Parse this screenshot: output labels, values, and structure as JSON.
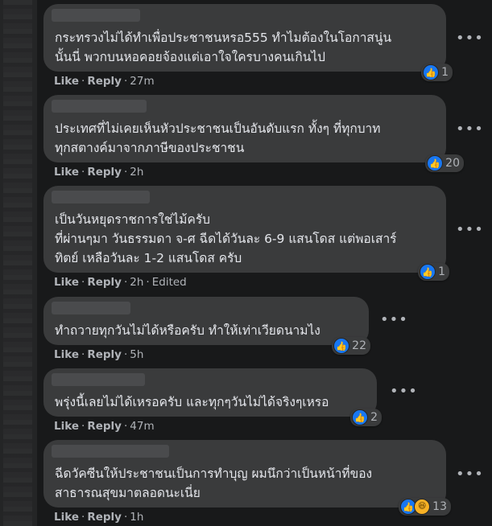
{
  "comments": [
    {
      "text": "กระทรวงไม่ได้ทำเพื่อประชาชนหรอ555 ทำไมต้องในโอกาสนู่น\nนั้นนี่ พวกบนหอคอยจ้องแต่เอาใจใครบางคนเกินไป",
      "like": "Like",
      "reply": "Reply",
      "time": "27m",
      "edited": "",
      "reactions": [
        "like"
      ],
      "reaction_count": "1"
    },
    {
      "text": "ประเทศที่ไม่เคยเห็นหัวประชาชนเป็นอันดับแรก ทั้งๆ ที่ทุกบาท\nทุกสตางค์มาจากภาษีของประชาชน",
      "like": "Like",
      "reply": "Reply",
      "time": "2h",
      "edited": "",
      "reactions": [
        "like"
      ],
      "reaction_count": "20"
    },
    {
      "text": "เป็นวันหยุดราชการใช่ไม้ครับ\nที่ผ่านๆมา วันธรรมดา จ-ศ ฉีดได้วันละ 6-9 แสนโดส แต่พอเสาร์\nทิตย์ เหลือวันละ 1-2 แสนโดส ครับ",
      "like": "Like",
      "reply": "Reply",
      "time": "2h",
      "edited": "Edited",
      "reactions": [
        "like"
      ],
      "reaction_count": "1"
    },
    {
      "text": "ทำถวายทุกวันไม่ได้หรือครับ ทำให้เท่าเวียดนามไง",
      "like": "Like",
      "reply": "Reply",
      "time": "5h",
      "edited": "",
      "reactions": [
        "like"
      ],
      "reaction_count": "22"
    },
    {
      "text": "พรุ่งนี้เลยไม่ได้เหรอครับ และทุกๆวันไม่ได้จริงๆเหรอ",
      "like": "Like",
      "reply": "Reply",
      "time": "47m",
      "edited": "",
      "reactions": [
        "like"
      ],
      "reaction_count": "2"
    },
    {
      "text": "ฉีดวัคซีนให้ประชาชนเป็นการทำบุญ ผมนึกว่าเป็นหน้าที่ของ\nสาธารณสุขมาตลอดนะเนี่ย",
      "like": "Like",
      "reply": "Reply",
      "time": "1h",
      "edited": "",
      "reactions": [
        "like",
        "haha"
      ],
      "reaction_count": "13"
    }
  ],
  "more_label": "•••",
  "separator": "·",
  "icons": {
    "like": "like-icon",
    "haha": "haha-icon",
    "more": "more-options-icon"
  },
  "colors": {
    "accent": "#1877f2",
    "bubble": "#3a3b3c",
    "background": "#18191a"
  }
}
